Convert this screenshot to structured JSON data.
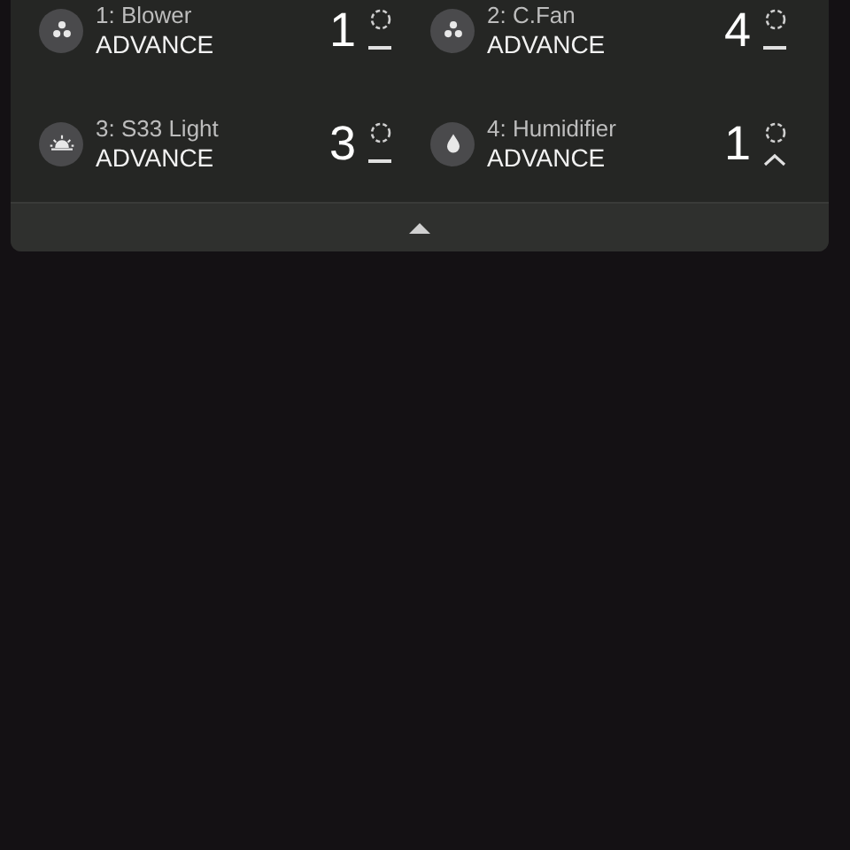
{
  "zones": [
    {
      "kind": "fan",
      "name": "1: Blower",
      "mode": "ADVANCE",
      "value": "1",
      "rising": false
    },
    {
      "kind": "fan",
      "name": "2: C.Fan",
      "mode": "ADVANCE",
      "value": "4",
      "rising": false
    },
    {
      "kind": "light",
      "name": "3: S33 Light",
      "mode": "ADVANCE",
      "value": "3",
      "rising": false
    },
    {
      "kind": "drop",
      "name": "4: Humidifier",
      "mode": "ADVANCE",
      "value": "1",
      "rising": true
    }
  ],
  "collapse": {
    "expanded": true
  }
}
